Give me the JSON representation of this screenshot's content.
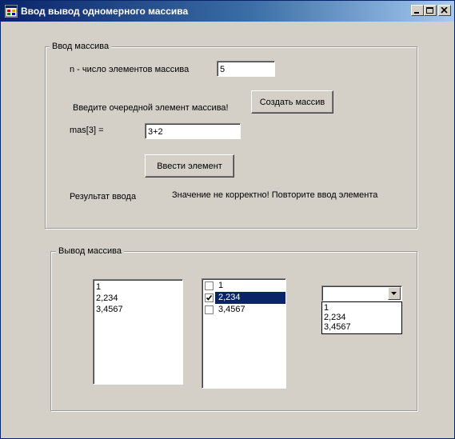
{
  "window": {
    "title": "Ввод вывод одномерного массива",
    "app_icon": "windows-form-icon",
    "controls": [
      "minimize-icon",
      "maximize-icon",
      "close-icon"
    ]
  },
  "input_group": {
    "legend": "Ввод массива",
    "n_label": "n - число элементов массива",
    "n_value": "5",
    "prompt_label": "Введите очередной элемент массива!",
    "create_button": "Создать массив",
    "element_label": "mas[3] =",
    "element_value": "3+2",
    "enter_button": "Ввести элемент",
    "result_label": "Результат ввода",
    "result_message": "Значение не корректно! Повторите ввод элемента"
  },
  "output_group": {
    "legend": "Вывод массива",
    "listbox_items": [
      "1",
      "2,234",
      "3,4567"
    ],
    "checked_list_items": [
      {
        "label": "1",
        "checked": false,
        "selected": false
      },
      {
        "label": "2,234",
        "checked": true,
        "selected": true
      },
      {
        "label": "3,4567",
        "checked": false,
        "selected": false
      }
    ],
    "combo_value": "",
    "combo_items": [
      "1",
      "2,234",
      "3,4567"
    ]
  },
  "colors": {
    "face": "#d4d0c8",
    "title_start": "#0a246a",
    "title_end": "#a6caf0",
    "selection": "#0a246a"
  }
}
